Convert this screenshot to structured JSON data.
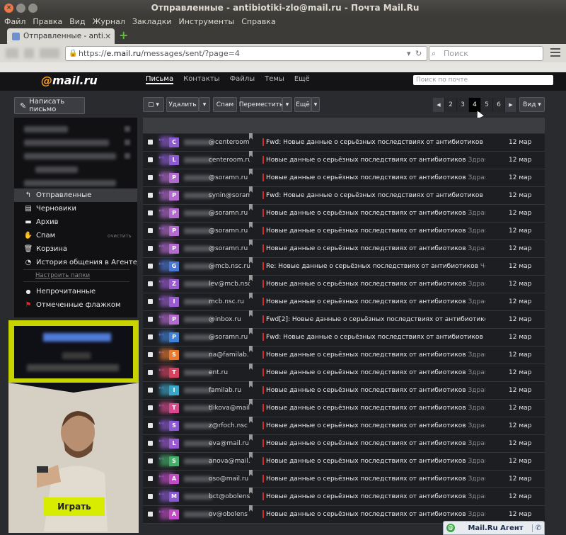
{
  "window": {
    "title": "Отправленные - antibiotiki-zlo@mail.ru - Почта Mail.Ru"
  },
  "menu": [
    "Файл",
    "Правка",
    "Вид",
    "Журнал",
    "Закладки",
    "Инструменты",
    "Справка"
  ],
  "tab": {
    "label": "Отправленные - anti..."
  },
  "address": {
    "scheme": "https://",
    "host": "e.mail.ru",
    "path": "/messages/sent/?page=4"
  },
  "browser_search": {
    "placeholder": "Поиск"
  },
  "mail_header": {
    "logo_at": "@",
    "logo_text": "mail.ru",
    "nav": [
      "Письма",
      "Контакты",
      "Файлы",
      "Темы",
      "Ещё"
    ],
    "search_placeholder": "Поиск по почте"
  },
  "compose": {
    "label": "Написать письмо"
  },
  "folders": [
    {
      "icon": "reply-icon",
      "glyph": "↰",
      "label": "Отправленные",
      "active": true,
      "count": ""
    },
    {
      "icon": "draft-icon",
      "glyph": "▤",
      "label": "Черновики",
      "active": false,
      "count": ""
    },
    {
      "icon": "archive-icon",
      "glyph": "▬",
      "label": "Архив",
      "active": false,
      "count": ""
    },
    {
      "icon": "spam-icon",
      "glyph": "✋",
      "label": "Спам",
      "active": false,
      "count": "очистить"
    },
    {
      "icon": "trash-icon",
      "glyph": "🗑",
      "label": "Корзина",
      "active": false,
      "count": ""
    },
    {
      "icon": "history-icon",
      "glyph": "◔",
      "label": "История общения в Агенте",
      "active": false,
      "count": ""
    }
  ],
  "folder_settings": "Настроить папки",
  "filters": [
    {
      "icon": "unread-icon",
      "glyph": "●",
      "label": "Непрочитанные",
      "color": "#ffffff"
    },
    {
      "icon": "flag-icon",
      "glyph": "⚑",
      "label": "Отмеченные флажком",
      "color": "#d52a2a"
    }
  ],
  "ad": {
    "button": "Играть"
  },
  "toolbar": {
    "delete": "Удалить",
    "spam": "Спам",
    "move": "Переместить",
    "more": "Ещё",
    "view": "Вид"
  },
  "pager": {
    "pages": [
      "2",
      "3",
      "4",
      "5",
      "6"
    ],
    "current": "4"
  },
  "messages": [
    {
      "from": "@centeroom.ru",
      "subject": "Fwd: Новые данные о серьёзных последствиях от антибиотиков",
      "snippet": "Здравствуйте",
      "date": "12 мар",
      "avatar_letter": "C",
      "avatar_color": "#8d5bd0"
    },
    {
      "from": "centeroom.ru",
      "subject": "Новые данные о серьёзных последствиях от антибиотиков",
      "snippet": "Здравствуйте",
      "date": "12 мар",
      "avatar_letter": "L",
      "avatar_color": "#8d5bd0"
    },
    {
      "from": "@soramn.ru",
      "subject": "Новые данные о серьёзных последствиях от антибиотиков",
      "snippet": "Здравствуйте",
      "date": "12 мар",
      "avatar_letter": "P",
      "avatar_color": "#b46bcf"
    },
    {
      "from": "synin@soram",
      "subject": "Fwd: Новые данные о серьёзных последствиях от антибиотиков",
      "snippet": "Здравствуйте",
      "date": "12 мар",
      "avatar_letter": "P",
      "avatar_color": "#b46bcf"
    },
    {
      "from": "@soramn.ru",
      "subject": "Новые данные о серьёзных последствиях от антибиотиков",
      "snippet": "Здравствуйте",
      "date": "12 мар",
      "avatar_letter": "P",
      "avatar_color": "#b46bcf"
    },
    {
      "from": "@soramn.ru",
      "subject": "Новые данные о серьёзных последствиях от антибиотиков",
      "snippet": "Здравствуйте",
      "date": "12 мар",
      "avatar_letter": "P",
      "avatar_color": "#b46bcf"
    },
    {
      "from": "@soramn.ru",
      "subject": "Новые данные о серьёзных последствиях от антибиотиков",
      "snippet": "Здравствуйте",
      "date": "12 мар",
      "avatar_letter": "P",
      "avatar_color": "#b46bcf"
    },
    {
      "from": "@mcb.nsc.ru",
      "subject": "Re: Новые данные о серьёзных последствиях от антибиотиков",
      "snippet": "Четверг",
      "date": "12 мар",
      "avatar_letter": "G",
      "avatar_color": "#4a78d4"
    },
    {
      "from": "lev@mcb.nsc",
      "subject": "Новые данные о серьёзных последствиях от антибиотиков",
      "snippet": "Здравствуйте",
      "date": "12 мар",
      "avatar_letter": "Z",
      "avatar_color": "#9a5bd0"
    },
    {
      "from": "mcb.nsc.ru",
      "subject": "Новые данные о серьёзных последствиях от антибиотиков",
      "snippet": "Здравствуйте",
      "date": "12 мар",
      "avatar_letter": "I",
      "avatar_color": "#9a5bd0"
    },
    {
      "from": "@inbox.ru",
      "subject": "Fwd[2]: Новые данные о серьёзных последствиях от антибиотиков",
      "snippet": "Здравствуйте",
      "date": "12 мар",
      "avatar_letter": "P",
      "avatar_color": "#b46bcf"
    },
    {
      "from": "@soramn.ru",
      "subject": "Fwd: Новые данные о серьёзных последствиях от антибиотиков",
      "snippet": "Здравствуйте",
      "date": "12 мар",
      "avatar_letter": "P",
      "avatar_color": "#3f82d6"
    },
    {
      "from": "na@familab.",
      "subject": "Новые данные о серьёзных последствиях от антибиотиков",
      "snippet": "Здравствуйте",
      "date": "12 мар",
      "avatar_letter": "S",
      "avatar_color": "#e8792e"
    },
    {
      "from": "ent.ru",
      "subject": "Новые данные о серьёзных последствиях от антибиотиков",
      "snippet": "Здравствуйте",
      "date": "12 мар",
      "avatar_letter": "T",
      "avatar_color": "#d8425e"
    },
    {
      "from": "familab.ru",
      "subject": "Новые данные о серьёзных последствиях от антибиотиков",
      "snippet": "Здравствуйте",
      "date": "12 мар",
      "avatar_letter": "I",
      "avatar_color": "#39a6c7"
    },
    {
      "from": "tlikova@mail",
      "subject": "Новые данные о серьёзных последствиях от антибиотиков",
      "snippet": "Здравствуйте",
      "date": "12 мар",
      "avatar_letter": "T",
      "avatar_color": "#d84a8c"
    },
    {
      "from": "z@rfoch.nsc",
      "subject": "Новые данные о серьёзных последствиях от антибиотиков",
      "snippet": "Здравствуйте",
      "date": "12 мар",
      "avatar_letter": "S",
      "avatar_color": "#8b59d2"
    },
    {
      "from": "eva@mail.ru",
      "subject": "Новые данные о серьёзных последствиях от антибиотиков",
      "snippet": "Здравствуйте",
      "date": "12 мар",
      "avatar_letter": "L",
      "avatar_color": "#9a5bd0"
    },
    {
      "from": "anova@mail.",
      "subject": "Новые данные о серьёзных последствиях от антибиотиков",
      "snippet": "Здравствуйте",
      "date": "12 мар",
      "avatar_letter": "S",
      "avatar_color": "#44b06a"
    },
    {
      "from": "oso@mail.ru",
      "subject": "Новые данные о серьёзных последствиях от антибиотиков",
      "snippet": "Здравствуйте",
      "date": "12 мар",
      "avatar_letter": "A",
      "avatar_color": "#c04dc4"
    },
    {
      "from": "bct@obolens",
      "subject": "Новые данные о серьёзных последствиях от антибиотиков",
      "snippet": "Здравствуйте",
      "date": "12 мар",
      "avatar_letter": "M",
      "avatar_color": "#8b59d2"
    },
    {
      "from": "ov@obolens",
      "subject": "Новые данные о серьёзных последствиях от антибиотиков",
      "snippet": "Здравствуйте",
      "date": "12 мар",
      "avatar_letter": "A",
      "avatar_color": "#c04dc4"
    }
  ],
  "agent": {
    "label": "Mail.Ru Агент"
  },
  "colors": {
    "accent": "#f59a23",
    "unread_bar": "#d52a2a",
    "ad_accent": "#c8d400"
  }
}
